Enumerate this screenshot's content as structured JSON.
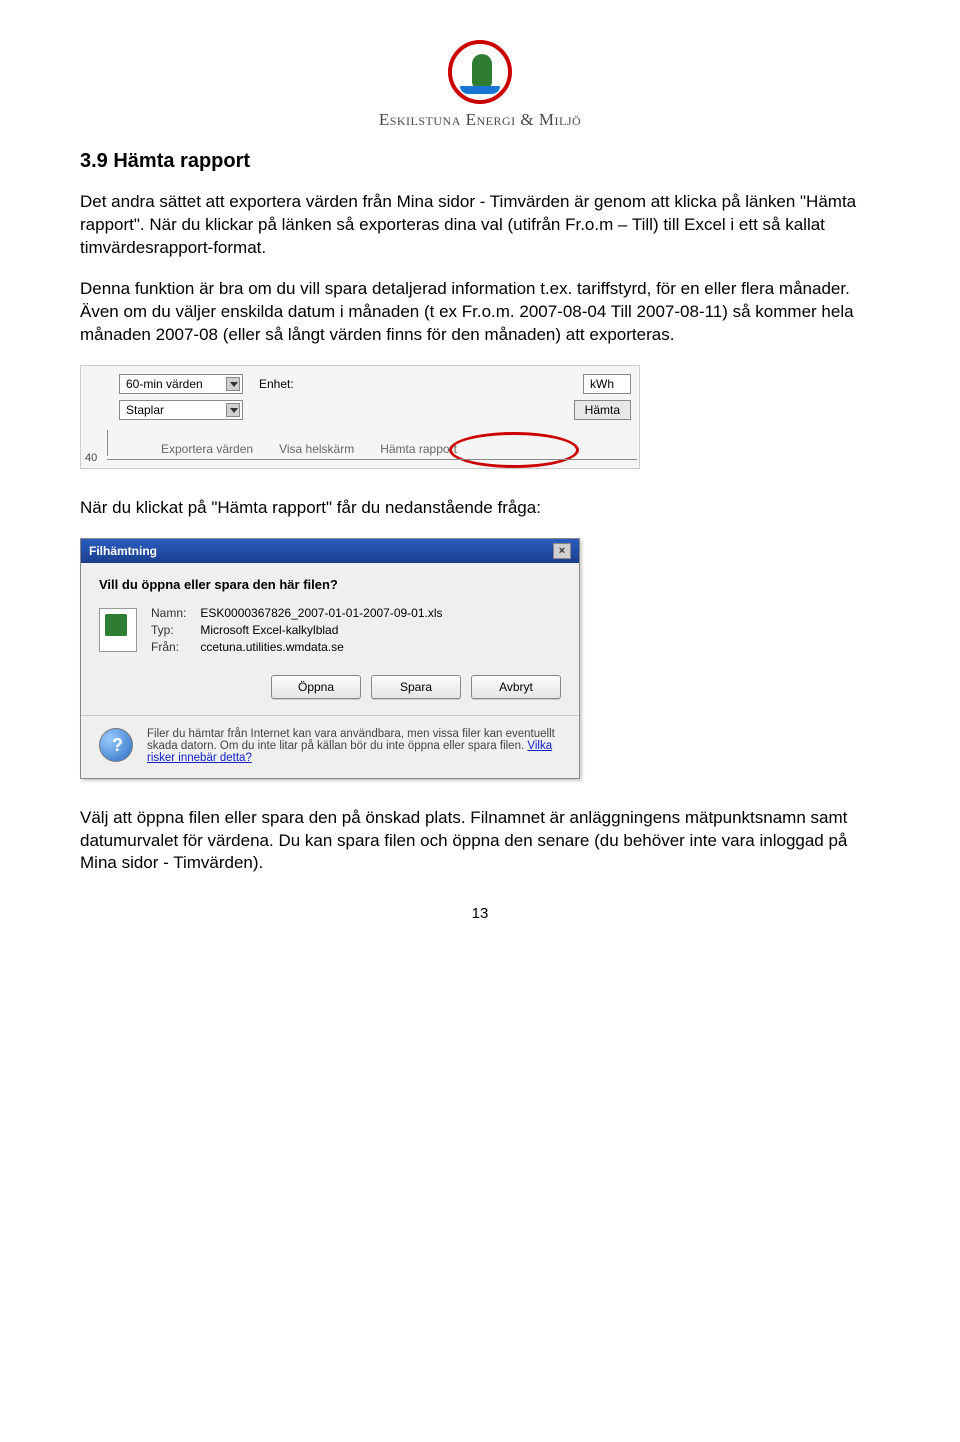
{
  "logo_name": "Eskilstuna Energi & Miljö",
  "heading": "3.9 Hämta rapport",
  "para1": "Det andra sättet att exportera värden från Mina sidor - Timvärden är genom att klicka på länken \"Hämta rapport\". När du klickar på länken så exporteras dina val (utifrån Fr.o.m – Till) till Excel i ett så kallat timvärdesrapport-format.",
  "para2": "Denna funktion är bra om du vill spara detaljerad information t.ex. tariffstyrd, för en eller flera månader. Även om du väljer enskilda datum i månaden (t ex Fr.o.m. 2007-08-04 Till 2007-08-11) så kommer hela månaden 2007-08 (eller så långt värden finns för den månaden) att exporteras.",
  "toolbar": {
    "granularity": "60-min värden",
    "unit_label": "Enhet:",
    "unit_value": "kWh",
    "chart_type": "Staplar",
    "fetch_button": "Hämta",
    "link_export": "Exportera värden",
    "link_fullscreen": "Visa helskärm",
    "link_report": "Hämta rapport",
    "y_tick": "40"
  },
  "para3": "När du klickat på \"Hämta rapport\" får du nedanstående fråga:",
  "dialog": {
    "title": "Filhämtning",
    "question": "Vill du öppna eller spara den här filen?",
    "name_label": "Namn:",
    "name_value": "ESK0000367826_2007-01-01-2007-09-01.xls",
    "type_label": "Typ:",
    "type_value": "Microsoft Excel-kalkylblad",
    "from_label": "Från:",
    "from_value": "ccetuna.utilities.wmdata.se",
    "btn_open": "Öppna",
    "btn_save": "Spara",
    "btn_cancel": "Avbryt",
    "warn_text": "Filer du hämtar från Internet kan vara användbara, men vissa filer kan eventuellt skada datorn. Om du inte litar på källan bör du inte öppna eller spara filen.",
    "warn_link": "Vilka risker innebär detta?"
  },
  "para4": "Välj att öppna filen eller spara den på önskad plats. Filnamnet är anläggningens mätpunktsnamn samt datumurvalet för värdena. Du kan spara filen och öppna den senare (du behöver inte vara inloggad på Mina sidor - Timvärden).",
  "page_number": "13"
}
